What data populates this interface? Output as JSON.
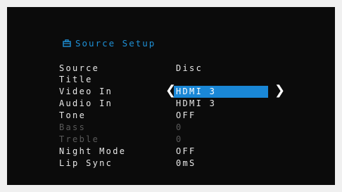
{
  "header": {
    "title": "Source Setup",
    "icon": "briefcase-icon"
  },
  "colors": {
    "accent": "#1a87d6",
    "background": "#0b0b0b",
    "text": "#e8e8e8",
    "disabled": "#5a5a5a"
  },
  "settings": [
    {
      "label": "Source",
      "value": "Disc",
      "disabled": false
    },
    {
      "label": "Title",
      "value": "",
      "disabled": false
    },
    {
      "label": "Video In",
      "value": "HDMI 3",
      "disabled": false,
      "selected": true
    },
    {
      "label": "Audio In",
      "value": "HDMI 3",
      "disabled": false
    },
    {
      "label": "Tone",
      "value": "OFF",
      "disabled": false
    },
    {
      "label": "Bass",
      "value": "0",
      "disabled": true
    },
    {
      "label": "Treble",
      "value": "0",
      "disabled": true
    },
    {
      "label": "Night Mode",
      "value": "OFF",
      "disabled": false
    },
    {
      "label": "Lip Sync",
      "value": "0mS",
      "disabled": false
    }
  ],
  "selector": {
    "left_arrow": "❮",
    "right_arrow": "❯"
  }
}
